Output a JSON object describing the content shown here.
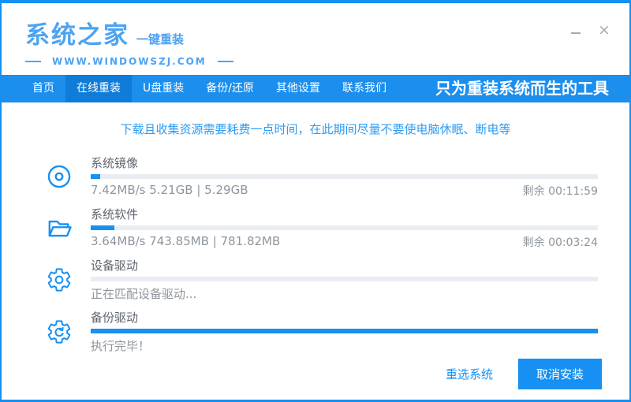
{
  "window": {
    "minimize_icon": "minimize-icon",
    "close_glyph": "×"
  },
  "header": {
    "logo_title": "系统之家",
    "logo_subtitle": "一键重装",
    "website": "WWW.WINDOWSZJ.COM"
  },
  "nav": {
    "tabs": [
      {
        "label": "首页",
        "active": false
      },
      {
        "label": "在线重装",
        "active": true
      },
      {
        "label": "U盘重装",
        "active": false
      },
      {
        "label": "备份/还原",
        "active": false
      },
      {
        "label": "其他设置",
        "active": false
      },
      {
        "label": "联系我们",
        "active": false
      }
    ],
    "slogan": "只为重装系统而生的工具"
  },
  "notice": "下载且收集资源需要耗费一点时间，在此期间尽量不要使电脑休眠、断电等",
  "tasks": [
    {
      "icon": "disc-icon",
      "label": "系统镜像",
      "progress_percent": 1.8,
      "status": "7.42MB/s 5.21GB | 5.29GB",
      "remaining": "剩余 00:11:59"
    },
    {
      "icon": "folder-icon",
      "label": "系统软件",
      "progress_percent": 4.6,
      "status": "3.64MB/s 743.85MB | 781.82MB",
      "remaining": "剩余 00:03:24"
    },
    {
      "icon": "gear-icon",
      "label": "设备驱动",
      "progress_percent": 0,
      "status": "正在匹配设备驱动...",
      "remaining": ""
    },
    {
      "icon": "gear-sync-icon",
      "label": "备份驱动",
      "progress_percent": 100,
      "status": "执行完毕！",
      "remaining": ""
    }
  ],
  "footer": {
    "reselect_label": "重选系统",
    "cancel_label": "取消安装"
  },
  "colors": {
    "accent": "#1690f2",
    "accent-dark": "#0e7cd8",
    "nav": "#1b8eee",
    "logo": "#4da3f2",
    "notice": "#2b9cf4",
    "bar-bg": "#e9edf2",
    "label": "#5f6670",
    "muted": "#8e959c",
    "control": "#a6abb0"
  }
}
